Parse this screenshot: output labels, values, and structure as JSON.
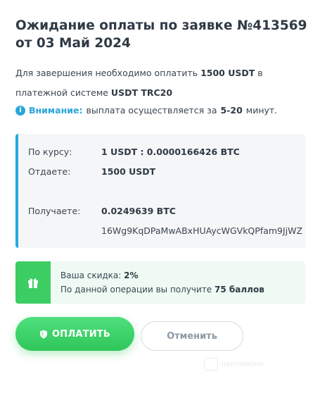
{
  "title": "Ожидание оплаты по заявке №413569 от 03 Май 2024",
  "description": {
    "prefix": "Для завершения необходимо оплатить",
    "amount": "1500 USDT",
    "middle": "в платежной системе",
    "system": "USDT TRC20"
  },
  "notice": {
    "label": "Внимание:",
    "text": "выплата осуществляется за",
    "time": "5-20",
    "suffix": "минут."
  },
  "exchange": {
    "rate_label": "По курсу:",
    "rate_value": "1 USDT : 0.0000166426 BTC",
    "give_label": "Отдаете:",
    "give_value": "1500 USDT",
    "receive_label": "Получаете:",
    "receive_value": "0.0249639 BTC",
    "address": "16Wg9KqDPaMwABxHUAycWGVkQPfam9JjWZ"
  },
  "discount": {
    "label": "Ваша скидка:",
    "value": "2%",
    "points_text": "По данной операции вы получите",
    "points_value": "75 баллов"
  },
  "buttons": {
    "pay": "ОПЛАТИТЬ",
    "cancel": "Отменить"
  },
  "watermark": "ПАРТНЕРОНН",
  "icons": {
    "info": "info-icon",
    "gift": "gift-icon",
    "shield": "shield-icon"
  },
  "colors": {
    "accent_blue": "#26a9e0",
    "accent_green": "#3ccd63",
    "text_dark": "#2f3a45",
    "panel_bg": "#f5f6f8",
    "discount_bg": "#eefaf3"
  }
}
